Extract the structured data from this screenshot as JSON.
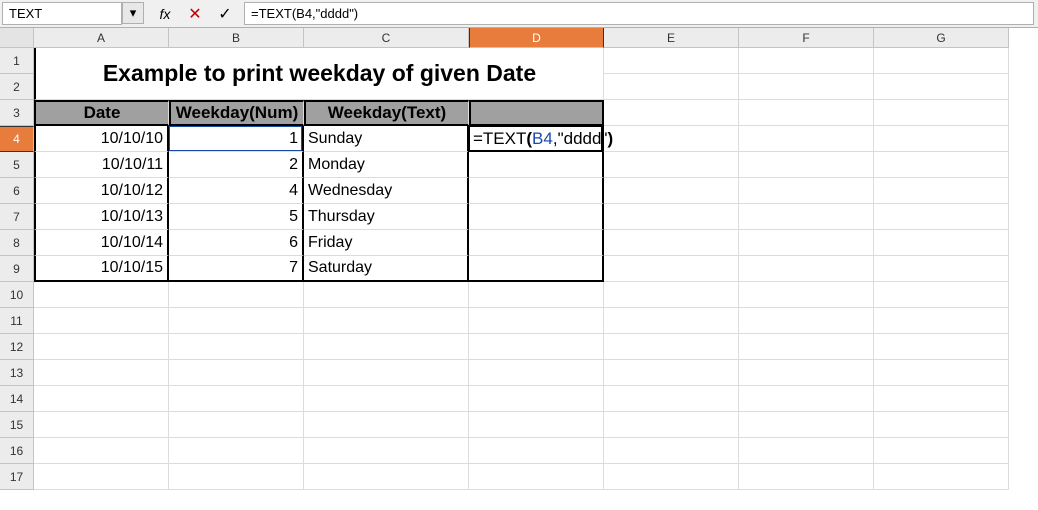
{
  "formula_bar": {
    "name_box": "TEXT",
    "fx_label": "fx",
    "cancel_glyph": "✕",
    "accept_glyph": "✓",
    "dropdown_glyph": "▾",
    "formula_text": "=TEXT(B4,\"dddd\")"
  },
  "columns": [
    "A",
    "B",
    "C",
    "D",
    "E",
    "F",
    "G"
  ],
  "rows": [
    "1",
    "2",
    "3",
    "4",
    "5",
    "6",
    "7",
    "8",
    "9",
    "10",
    "11",
    "12",
    "13",
    "14",
    "15",
    "16",
    "17"
  ],
  "active_column": "D",
  "active_row": "4",
  "accent_color": "#e77c3c",
  "title": "Example to print weekday of given Date",
  "headers": {
    "date": "Date",
    "wnum": "Weekday(Num)",
    "wtext": "Weekday(Text)"
  },
  "data_rows": [
    {
      "date": "10/10/10",
      "num": "1",
      "text": "Sunday"
    },
    {
      "date": "10/10/11",
      "num": "2",
      "text": "Monday"
    },
    {
      "date": "10/10/12",
      "num": "4",
      "text": "Wednesday"
    },
    {
      "date": "10/10/13",
      "num": "5",
      "text": "Thursday"
    },
    {
      "date": "10/10/14",
      "num": "6",
      "text": "Friday"
    },
    {
      "date": "10/10/15",
      "num": "7",
      "text": "Saturday"
    }
  ],
  "editing_formula": {
    "prefix": "=TEXT",
    "paren_open": "(",
    "ref": "B4",
    "comma": ",",
    "str": "\"dddd\"",
    "paren_close": ")"
  },
  "chart_data": {
    "type": "table",
    "title": "Example to print weekday of given Date",
    "columns": [
      "Date",
      "Weekday(Num)",
      "Weekday(Text)"
    ],
    "rows": [
      [
        "10/10/10",
        1,
        "Sunday"
      ],
      [
        "10/10/11",
        2,
        "Monday"
      ],
      [
        "10/10/12",
        4,
        "Wednesday"
      ],
      [
        "10/10/13",
        5,
        "Thursday"
      ],
      [
        "10/10/14",
        6,
        "Friday"
      ],
      [
        "10/10/15",
        7,
        "Saturday"
      ]
    ]
  }
}
